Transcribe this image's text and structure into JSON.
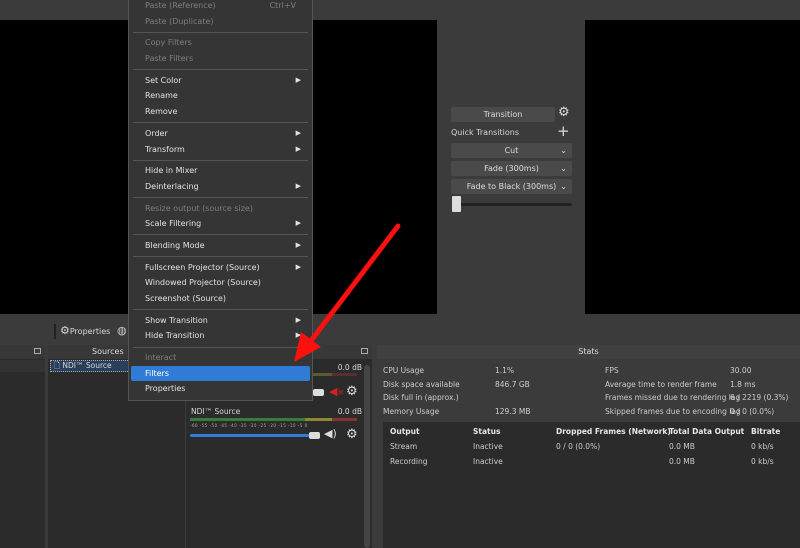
{
  "toolbar": {
    "properties_label": "Properties"
  },
  "transition_panel": {
    "transition_button": "Transition",
    "quick_transitions_label": "Quick Transitions",
    "quick": [
      "Cut",
      "Fade (300ms)",
      "Fade to Black (300ms)"
    ]
  },
  "docks": {
    "sources_title": "Sources",
    "stats_title": "Stats"
  },
  "sources": [
    {
      "name": "NDI™ Source"
    }
  ],
  "mixer": [
    {
      "name": "",
      "db": "0.0 dB",
      "muted": true
    },
    {
      "name": "NDI™ Source",
      "db": "0.0 dB",
      "muted": false
    }
  ],
  "meter_scale": "-60 -55 -50 -45 -40 -35 -30 -25 -20 -15 -10 -5 0",
  "context_menu": {
    "paste_reference": "Paste (Reference)",
    "paste_reference_shortcut": "Ctrl+V",
    "paste_duplicate": "Paste (Duplicate)",
    "copy_filters": "Copy Filters",
    "paste_filters": "Paste Filters",
    "set_color": "Set Color",
    "rename": "Rename",
    "remove": "Remove",
    "order": "Order",
    "transform": "Transform",
    "hide_in_mixer": "Hide in Mixer",
    "deinterlacing": "Deinterlacing",
    "resize_output": "Resize output (source size)",
    "scale_filtering": "Scale Filtering",
    "blending_mode": "Blending Mode",
    "fullscreen_projector": "Fullscreen Projector (Source)",
    "windowed_projector": "Windowed Projector (Source)",
    "screenshot": "Screenshot (Source)",
    "show_transition": "Show Transition",
    "hide_transition": "Hide Transition",
    "interact": "Interact",
    "filters": "Filters",
    "properties": "Properties"
  },
  "stats": {
    "cpu_label": "CPU Usage",
    "cpu": "1.1%",
    "disk_label": "Disk space available",
    "disk": "846.7 GB",
    "diskfull_label": "Disk full in (approx.)",
    "mem_label": "Memory Usage",
    "mem": "129.3 MB",
    "fps_label": "FPS",
    "fps": "30.00",
    "render_label": "Average time to render frame",
    "render": "1.8 ms",
    "missed_label": "Frames missed due to rendering lag",
    "missed": "6 / 2219 (0.3%)",
    "skipped_label": "Skipped frames due to encoding lag",
    "skipped": "0 / 0 (0.0%)",
    "headers": [
      "Output",
      "Status",
      "Dropped Frames (Network)",
      "Total Data Output",
      "Bitrate"
    ],
    "rows": [
      [
        "Stream",
        "Inactive",
        "0 / 0 (0.0%)",
        "0.0 MB",
        "0 kb/s"
      ],
      [
        "Recording",
        "Inactive",
        "",
        "0.0 MB",
        "0 kb/s"
      ]
    ]
  },
  "colors": {
    "highlight": "#2f7bd6",
    "arrow": "#ff1010",
    "muted": "#d42020"
  }
}
